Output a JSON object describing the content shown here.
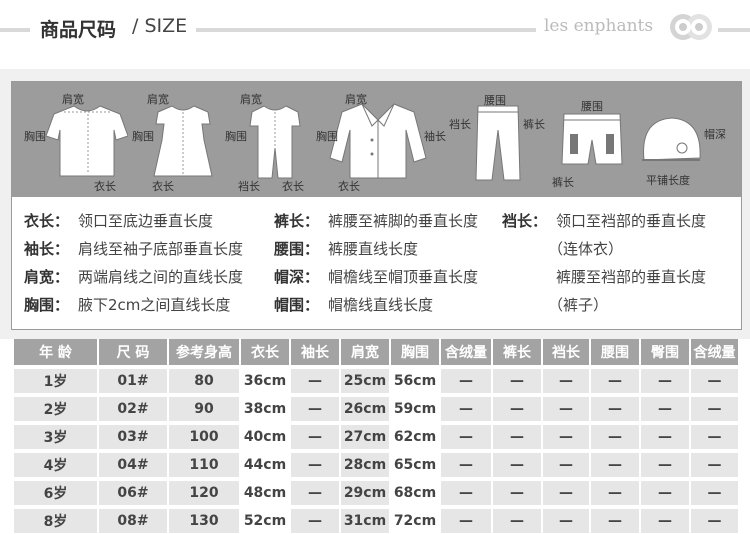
{
  "header": {
    "title_cn": "商品尺码",
    "title_en": "/ SIZE",
    "brand": "les enphants"
  },
  "garments": [
    {
      "icon": "tshirt-icon",
      "labels": [
        "肩宽",
        "胸围",
        "衣长"
      ]
    },
    {
      "icon": "dress-icon",
      "labels": [
        "肩宽",
        "胸围",
        "衣长"
      ]
    },
    {
      "icon": "jumpsuit-icon",
      "labels": [
        "肩宽",
        "胸围",
        "裆长",
        "衣长"
      ]
    },
    {
      "icon": "jacket-icon",
      "labels": [
        "肩宽",
        "胸围",
        "衣长",
        "袖长"
      ]
    },
    {
      "icon": "long-pants-icon",
      "labels": [
        "腰围",
        "裆长",
        "裤长"
      ]
    },
    {
      "icon": "shorts-icon",
      "labels": [
        "腰围",
        "裤长"
      ]
    },
    {
      "icon": "hat-icon",
      "labels": [
        "帽深",
        "平铺长度"
      ]
    }
  ],
  "definitions": [
    {
      "key": "衣长：",
      "value": "领口至底边垂直长度"
    },
    {
      "key": "袖长：",
      "value": "肩线至袖子底部垂直长度"
    },
    {
      "key": "肩宽：",
      "value": "两端肩线之间的直线长度"
    },
    {
      "key": "胸围：",
      "value": "腋下2cm之间直线长度"
    },
    {
      "key": "裤长：",
      "value": "裤腰至裤脚的垂直长度"
    },
    {
      "key": "腰围：",
      "value": "裤腰直线长度"
    },
    {
      "key": "帽深：",
      "value": "帽檐线至帽顶垂直长度"
    },
    {
      "key": "帽围：",
      "value": "帽檐线直线长度"
    },
    {
      "key": "裆长：",
      "value": "领口至裆部的垂直长度"
    },
    {
      "key": "",
      "value": "（连体衣）"
    },
    {
      "key": "",
      "value": "裤腰至裆部的垂直长度"
    },
    {
      "key": "",
      "value": "（裤子）"
    }
  ],
  "table": {
    "headers": [
      "年 龄",
      "尺 码",
      "参考身高",
      "衣长",
      "袖长",
      "肩宽",
      "胸围",
      "含绒量",
      "裤长",
      "裆长",
      "腰围",
      "臀围",
      "含绒量"
    ],
    "rows": [
      [
        "1岁",
        "01#",
        "80",
        "36cm",
        "—",
        "25cm",
        "56cm",
        "—",
        "—",
        "—",
        "—",
        "—",
        "—"
      ],
      [
        "2岁",
        "02#",
        "90",
        "38cm",
        "—",
        "26cm",
        "59cm",
        "—",
        "—",
        "—",
        "—",
        "—",
        "—"
      ],
      [
        "3岁",
        "03#",
        "100",
        "40cm",
        "—",
        "27cm",
        "62cm",
        "—",
        "—",
        "—",
        "—",
        "—",
        "—"
      ],
      [
        "4岁",
        "04#",
        "110",
        "44cm",
        "—",
        "28cm",
        "65cm",
        "—",
        "—",
        "—",
        "—",
        "—",
        "—"
      ],
      [
        "6岁",
        "06#",
        "120",
        "48cm",
        "—",
        "29cm",
        "68cm",
        "—",
        "—",
        "—",
        "—",
        "—",
        "—"
      ],
      [
        "8岁",
        "08#",
        "130",
        "52cm",
        "—",
        "31cm",
        "72cm",
        "—",
        "—",
        "—",
        "—",
        "—",
        "—"
      ]
    ]
  }
}
